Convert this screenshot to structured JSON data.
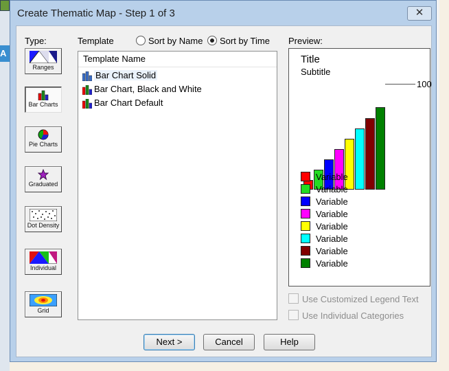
{
  "window": {
    "title": "Create Thematic Map - Step 1 of 3",
    "close_glyph": "✕"
  },
  "background": {
    "partial_label": "A"
  },
  "type_panel": {
    "label": "Type:",
    "items": [
      {
        "label": "Ranges",
        "icon": "ranges-icon",
        "selected": false
      },
      {
        "label": "Bar Charts",
        "icon": "bar-charts-icon",
        "selected": true
      },
      {
        "label": "Pie Charts",
        "icon": "pie-charts-icon",
        "selected": false
      },
      {
        "label": "Graduated",
        "icon": "graduated-icon",
        "selected": false
      },
      {
        "label": "Dot Density",
        "icon": "dot-density-icon",
        "selected": false
      },
      {
        "label": "Individual",
        "icon": "individual-icon",
        "selected": false
      },
      {
        "label": "Grid",
        "icon": "grid-icon",
        "selected": false
      }
    ]
  },
  "template": {
    "label": "Template",
    "sort_name_label": "Sort by Name",
    "sort_time_label": "Sort by Time",
    "sort_selected": "time",
    "column_header": "Template Name",
    "items": [
      {
        "label": "Bar Chart Solid",
        "selected": true
      },
      {
        "label": "Bar Chart, Black and White",
        "selected": false
      },
      {
        "label": "Bar Chart Default",
        "selected": false
      }
    ]
  },
  "preview": {
    "label": "Preview:",
    "title": "Title",
    "subtitle": "Subtitle",
    "max_label": "100",
    "bars": [
      {
        "color": "#ff0000",
        "value": 12
      },
      {
        "color": "#22dd22",
        "value": 24
      },
      {
        "color": "#0000ff",
        "value": 37
      },
      {
        "color": "#ff00ff",
        "value": 49
      },
      {
        "color": "#ffff00",
        "value": 62
      },
      {
        "color": "#00ffff",
        "value": 74
      },
      {
        "color": "#800000",
        "value": 87
      },
      {
        "color": "#008000",
        "value": 100
      }
    ],
    "legend": [
      {
        "label": "Variable",
        "color": "#ff0000"
      },
      {
        "label": "Variable",
        "color": "#22dd22"
      },
      {
        "label": "Variable",
        "color": "#0000ff"
      },
      {
        "label": "Variable",
        "color": "#ff00ff"
      },
      {
        "label": "Variable",
        "color": "#ffff00"
      },
      {
        "label": "Variable",
        "color": "#00ffff"
      },
      {
        "label": "Variable",
        "color": "#800000"
      },
      {
        "label": "Variable",
        "color": "#008000"
      }
    ]
  },
  "options": {
    "custom_legend_label": "Use Customized Legend Text",
    "individual_categories_label": "Use Individual Categories",
    "custom_legend_checked": false,
    "individual_categories_checked": false,
    "enabled": false
  },
  "buttons": {
    "next": "Next >",
    "cancel": "Cancel",
    "help": "Help"
  }
}
